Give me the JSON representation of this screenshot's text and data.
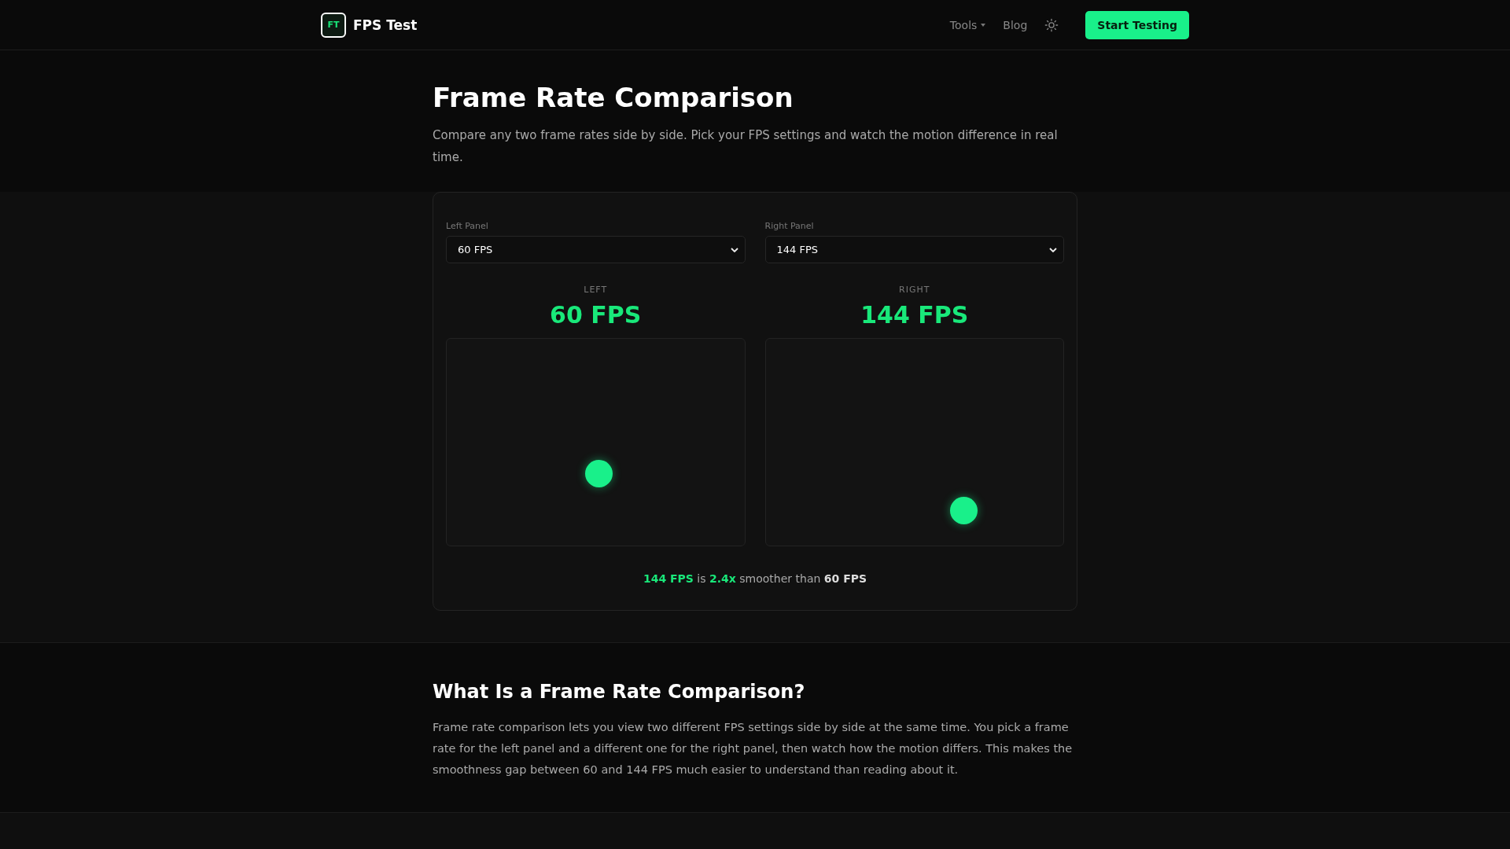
{
  "header": {
    "logo_mark": "FT",
    "brand": "FPS Test",
    "nav": [
      {
        "label": "Tools",
        "kind": "dropdown"
      },
      {
        "label": "Blog",
        "kind": "link"
      }
    ],
    "cta": "Start Testing"
  },
  "hero": {
    "title": "Frame Rate Comparison",
    "description": "Compare any two frame rates side by side. Pick your FPS settings and watch the motion difference in real time."
  },
  "comparison": {
    "panels": [
      {
        "select_label": "Left Panel",
        "value": "60 FPS",
        "caption": "LEFT",
        "fps": "60 FPS"
      },
      {
        "select_label": "Right Panel",
        "value": "144 FPS",
        "caption": "RIGHT",
        "fps": "144 FPS"
      }
    ],
    "summary": [
      {
        "text": "144 FPS",
        "kind": "accent"
      },
      {
        "text": " is ",
        "kind": "plain"
      },
      {
        "text": "2.4x",
        "kind": "accent"
      },
      {
        "text": " smoother than ",
        "kind": "plain"
      },
      {
        "text": "60 FPS",
        "kind": "strong"
      }
    ]
  },
  "about": {
    "title": "What Is a Frame Rate Comparison?",
    "body": "Frame rate comparison lets you view two different FPS settings side by side at the same time. You pick a frame rate for the left panel and a different one for the right panel, then watch how the motion differs. This makes the smoothness gap between 60 and 144 FPS much easier to understand than reading about it."
  }
}
